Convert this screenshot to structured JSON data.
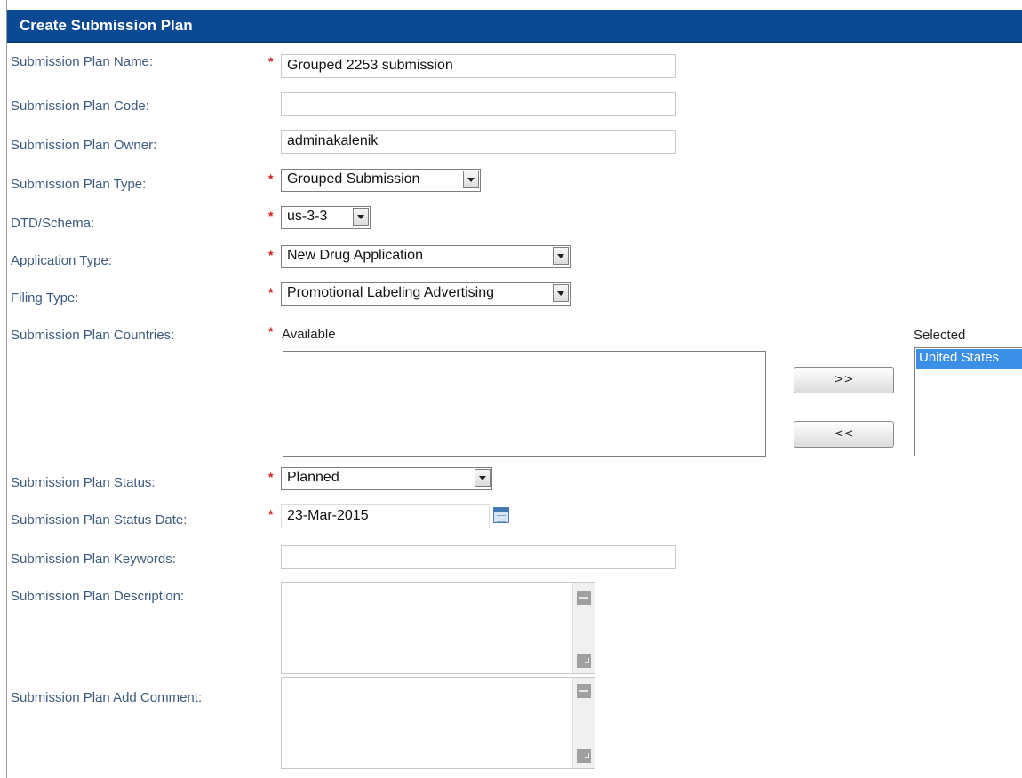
{
  "header": {
    "title": "Create Submission Plan"
  },
  "fields": {
    "name": {
      "label": "Submission Plan Name:",
      "value": "Grouped 2253 submission",
      "required": true
    },
    "code": {
      "label": "Submission Plan Code:",
      "value": "",
      "required": false
    },
    "owner": {
      "label": "Submission Plan Owner:",
      "value": "adminakalenik",
      "required": false
    },
    "type": {
      "label": "Submission Plan Type:",
      "value": "Grouped Submission",
      "required": true
    },
    "dtd": {
      "label": "DTD/Schema:",
      "value": "us-3-3",
      "required": true
    },
    "app_type": {
      "label": "Application Type:",
      "value": "New Drug Application",
      "required": true
    },
    "filing_type": {
      "label": "Filing Type:",
      "value": "Promotional Labeling Advertising",
      "required": true
    },
    "countries": {
      "label": "Submission Plan Countries:",
      "required": true,
      "available_label": "Available",
      "selected_label": "Selected",
      "available": [],
      "selected": [
        "United States"
      ],
      "add_button": ">>",
      "remove_button": "<<"
    },
    "status": {
      "label": "Submission Plan Status:",
      "value": "Planned",
      "required": true
    },
    "status_date": {
      "label": "Submission Plan Status Date:",
      "value": "23-Mar-2015",
      "required": true
    },
    "keywords": {
      "label": "Submission Plan Keywords:",
      "value": ""
    },
    "description": {
      "label": "Submission Plan Description:",
      "value": ""
    },
    "comment": {
      "label": "Submission Plan Add Comment:",
      "value": ""
    }
  },
  "icons": {
    "required_marker": "asterisk",
    "dropdown": "chevron-down-icon",
    "calendar": "calendar-icon"
  },
  "colors": {
    "header_bg": "#0b4a93",
    "label_text": "#3c5a7e",
    "required_marker": "#d02020",
    "selected_option_bg": "#3b8fe6"
  }
}
